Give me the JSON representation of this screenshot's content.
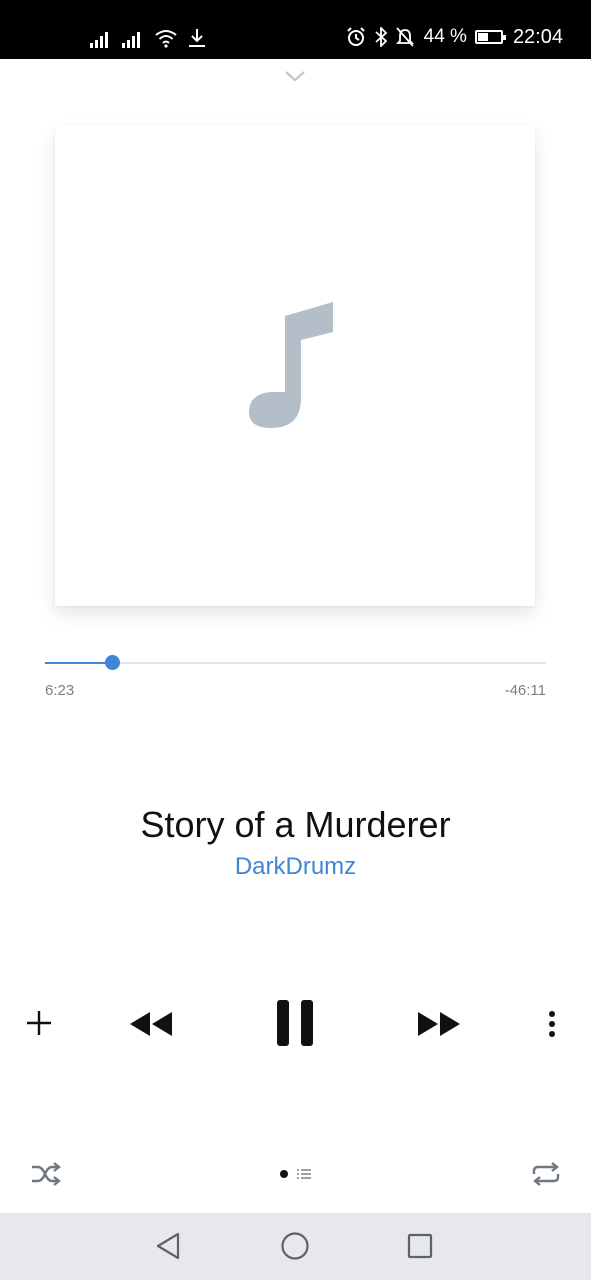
{
  "status_bar": {
    "battery_percent": "44 %",
    "time": "22:04",
    "icons": [
      "signal-icon",
      "signal-icon",
      "wifi-icon",
      "download-icon",
      "alarm-icon",
      "bluetooth-icon",
      "mute-icon",
      "battery-icon"
    ]
  },
  "player": {
    "artwork_icon": "music-note-icon",
    "progress_fraction": 0.133,
    "elapsed": "6:23",
    "remaining": "-46:11",
    "title": "Story of a Murderer",
    "artist": "DarkDrumz",
    "state": "playing"
  },
  "controls": [
    "add-icon",
    "rewind-icon",
    "pause-icon",
    "fast-forward-icon",
    "more-vertical-icon"
  ],
  "footer": {
    "icons": [
      "shuffle-icon",
      "page-indicator-dot",
      "queue-list-icon",
      "repeat-icon"
    ]
  },
  "colors": {
    "accent": "#3f86d6",
    "artwork_glyph": "#b3bec9",
    "status_bar": "#000000",
    "nav_bar": "#e6e8eb"
  }
}
